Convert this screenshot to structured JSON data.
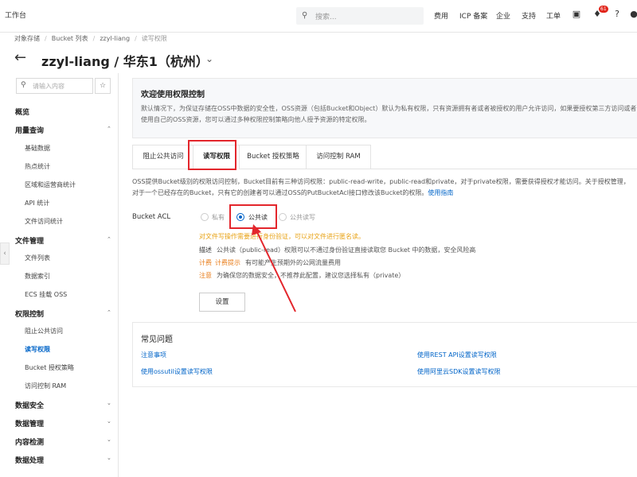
{
  "topbar": {
    "workbench": "工作台",
    "search_placeholder": "搜索...",
    "nav": [
      "费用",
      "ICP 备案",
      "企业",
      "支持",
      "工单"
    ],
    "badge": "61"
  },
  "breadcrumb": {
    "items": [
      "对象存储",
      "Bucket 列表",
      "zzyl-liang"
    ],
    "current": "读写权限"
  },
  "page": {
    "title": "zzyl-liang / 华东1（杭州）"
  },
  "sidebar": {
    "search_placeholder": "请输入内容",
    "overview": "概览",
    "groups": [
      {
        "label": "用量查询",
        "items": [
          "基础数据",
          "热点统计",
          "区域和运营商统计",
          "API 统计",
          "文件访问统计"
        ]
      },
      {
        "label": "文件管理",
        "items": [
          "文件列表",
          "数据索引",
          "ECS 挂载 OSS"
        ]
      },
      {
        "label": "权限控制",
        "items": [
          "阻止公共访问",
          "读写权限",
          "Bucket 授权策略",
          "访问控制 RAM"
        ]
      }
    ],
    "collapsed_groups": [
      "数据安全",
      "数据管理",
      "内容检测",
      "数据处理"
    ]
  },
  "welcome": {
    "title": "欢迎使用权限控制",
    "text": "默认情况下，为保证存储在OSS中数据的安全性，OSS资源（包括Bucket和Object）默认为私有权限，只有资源拥有者或者被授权的用户允许访问，如果要授权第三方访问或者使用自己的OSS资源，您可以通过多种权限控制策略向他人授予资源的特定权限。"
  },
  "tabs": [
    "阻止公共访问",
    "读写权限",
    "Bucket 授权策略",
    "访问控制 RAM"
  ],
  "description": {
    "line1": "OSS提供Bucket级别的权限访问控制，Bucket目前有三种访问权限：public-read-write，public-read和private，对于private权限，需要获得授权才能访问。关于授权管理，",
    "line2": "对于一个已经存在的Bucket，只有它的创建者可以通过OSS的PutBucketAcl接口修改该Bucket的权限。",
    "link": "使用指南"
  },
  "acl": {
    "label": "Bucket ACL",
    "options": [
      "私有",
      "公共读",
      "公共读写"
    ],
    "selected": "公共读",
    "warning": "对文件写操作需要进行身份验证，可以对文件进行匿名读。",
    "info": [
      {
        "key": "描述",
        "text": "公共读（public-read）权限可以不通过身份验证直接读取您 Bucket 中的数据，安全风险高"
      },
      {
        "key": "计费",
        "key2": "计费提示",
        "text": "有可能产生预期外的公网流量费用"
      },
      {
        "key": "注意",
        "text": "为确保您的数据安全，不推荐此配置，建议您选择私有（private）"
      }
    ],
    "button": "设置"
  },
  "faq": {
    "title": "常见问题",
    "links": [
      "注意事项",
      "使用REST API设置读写权限",
      "使用ossutil设置读写权限",
      "使用阿里云SDK设置读写权限"
    ]
  },
  "colors": {
    "accent": "#0064c8",
    "annotation_red": "#e3262c",
    "warning": "#e8a317"
  }
}
